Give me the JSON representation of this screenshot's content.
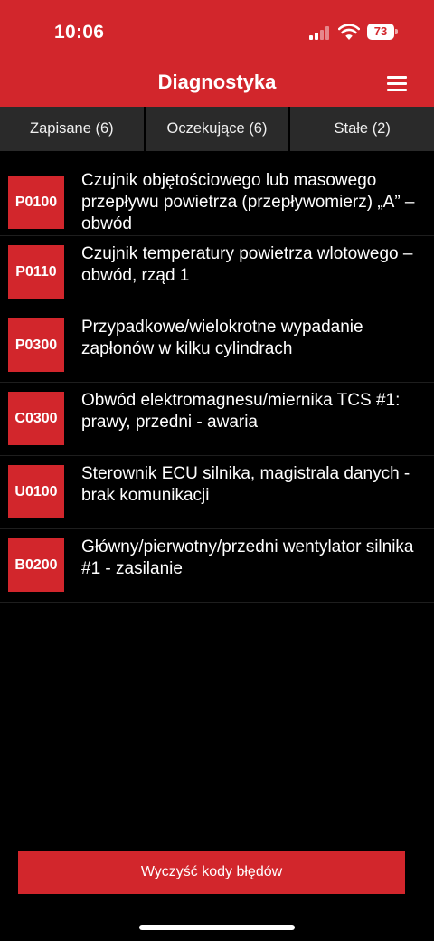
{
  "status_bar": {
    "time": "10:06",
    "battery_level": "73",
    "signal_bars_active": 2,
    "signal_bars_total": 4
  },
  "nav": {
    "title": "Diagnostyka",
    "menu_icon": "hamburger-menu-icon"
  },
  "tabs": [
    {
      "label": "Zapisane (6)"
    },
    {
      "label": "Oczekujące (6)"
    },
    {
      "label": "Stałe (2)"
    }
  ],
  "codes": [
    {
      "code": "P0100",
      "description": "Czujnik objętościowego lub masowego przepływu powietrza (przepływomierz) „A” – obwód"
    },
    {
      "code": "P0110",
      "description": "Czujnik temperatury powietrza wlotowego – obwód, rząd 1"
    },
    {
      "code": "P0300",
      "description": "Przypadkowe/wielokrotne wypadanie zapłonów w kilku cylindrach"
    },
    {
      "code": "C0300",
      "description": "Obwód elektromagnesu/miernika TCS #1: prawy, przedni - awaria"
    },
    {
      "code": "U0100",
      "description": "Sterownik ECU silnika, magistrala danych - brak komunikacji"
    },
    {
      "code": "B0200",
      "description": "Główny/pierwotny/przedni wentylator silnika #1 - zasilanie"
    }
  ],
  "actions": {
    "clear_label": "Wyczyść kody błędów"
  },
  "colors": {
    "accent": "#d2262c",
    "background": "#000000",
    "tab_background": "#2a2a2a"
  }
}
